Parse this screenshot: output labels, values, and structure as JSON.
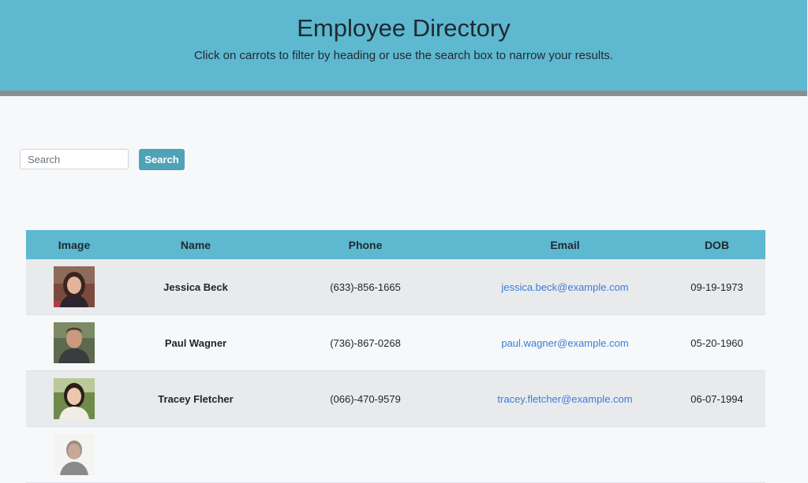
{
  "header": {
    "title": "Employee Directory",
    "subtitle": "Click on carrots to filter by heading or use the search box to narrow your results."
  },
  "search": {
    "placeholder": "Search",
    "value": "",
    "button_label": "Search"
  },
  "table": {
    "columns": [
      "Image",
      "Name",
      "Phone",
      "Email",
      "DOB"
    ],
    "rows": [
      {
        "name": "Jessica Beck",
        "phone": "(633)-856-1665",
        "email": "jessica.beck@example.com",
        "dob": "09-19-1973"
      },
      {
        "name": "Paul Wagner",
        "phone": "(736)-867-0268",
        "email": "paul.wagner@example.com",
        "dob": "05-20-1960"
      },
      {
        "name": "Tracey Fletcher",
        "phone": "(066)-470-9579",
        "email": "tracey.fletcher@example.com",
        "dob": "06-07-1994"
      },
      {
        "name": "",
        "phone": "",
        "email": "",
        "dob": ""
      }
    ]
  },
  "colors": {
    "header_bg": "#5eb8cf",
    "header_border": "#8b8d8e",
    "button_bg": "#4ea3b7",
    "link": "#3b7dd8",
    "row_stripe": "#e9eaeb"
  }
}
